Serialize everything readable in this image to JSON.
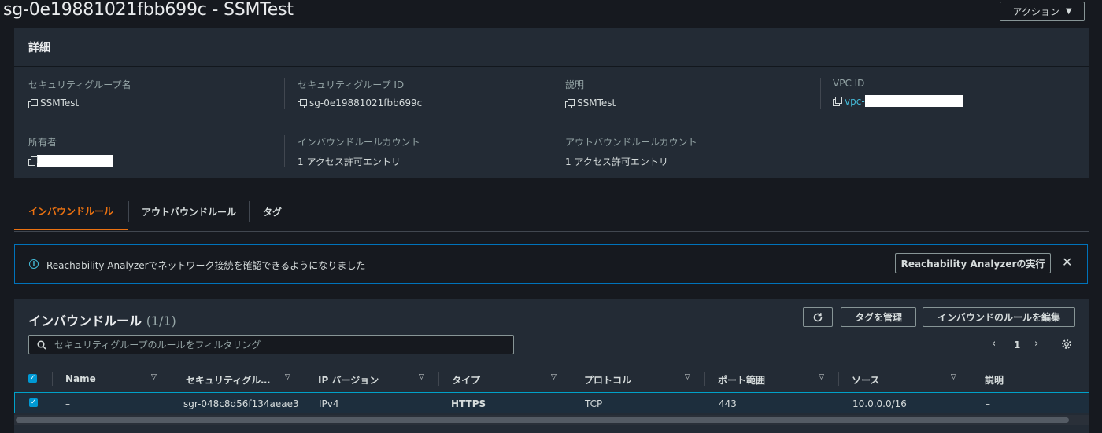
{
  "header": {
    "title": "sg-0e19881021fbb699c - SSMTest",
    "actions_label": "アクション",
    "actions_caret": "▼"
  },
  "details": {
    "title": "詳細",
    "fields": {
      "sg_name": {
        "label": "セキュリティグループ名",
        "value": "SSMTest"
      },
      "sg_id": {
        "label": "セキュリティグループ ID",
        "value": "sg-0e19881021fbb699c"
      },
      "description": {
        "label": "説明",
        "value": "SSMTest"
      },
      "vpc_id": {
        "label": "VPC ID",
        "value": "vpc-"
      },
      "owner": {
        "label": "所有者",
        "value": ""
      },
      "inbound_count": {
        "label": "インバウンドルールカウント",
        "value": "1 アクセス許可エントリ"
      },
      "outbound_count": {
        "label": "アウトバウンドルールカウント",
        "value": "1 アクセス許可エントリ"
      }
    }
  },
  "tabs": [
    {
      "label": "インバウンドルール",
      "active": true
    },
    {
      "label": "アウトバウンドルール",
      "active": false
    },
    {
      "label": "タグ",
      "active": false
    }
  ],
  "flash": {
    "icon": "i",
    "message": "Reachability Analyzerでネットワーク接続を確認できるようになりました",
    "button_label": "Reachability Analyzerの実行",
    "close": "✕"
  },
  "rules": {
    "title": "インバウンドルール",
    "count": "(1/1)",
    "manage_tags_label": "タグを管理",
    "edit_label": "インバウンドのルールを編集",
    "search_placeholder": "セキュリティグループのルールをフィルタリング",
    "page_prev": "‹",
    "page_number": "1",
    "page_next": "›",
    "columns": [
      "Name",
      "セキュリティグル…",
      "IP バージョン",
      "タイプ",
      "プロトコル",
      "ポート範囲",
      "ソース",
      "説明"
    ],
    "rows": [
      {
        "name": "–",
        "rule_id": "sgr-048c8d56f134aeae3",
        "ip_version": "IPv4",
        "type": "HTTPS",
        "protocol": "TCP",
        "port_range": "443",
        "source": "10.0.0.0/16",
        "description": "–"
      }
    ],
    "check": "✓"
  },
  "colors": {
    "background": "#16191f",
    "panel": "#232b35",
    "accent_orange": "#ec7211",
    "link_blue": "#44b9d6",
    "selected_border": "#00a1c9"
  }
}
